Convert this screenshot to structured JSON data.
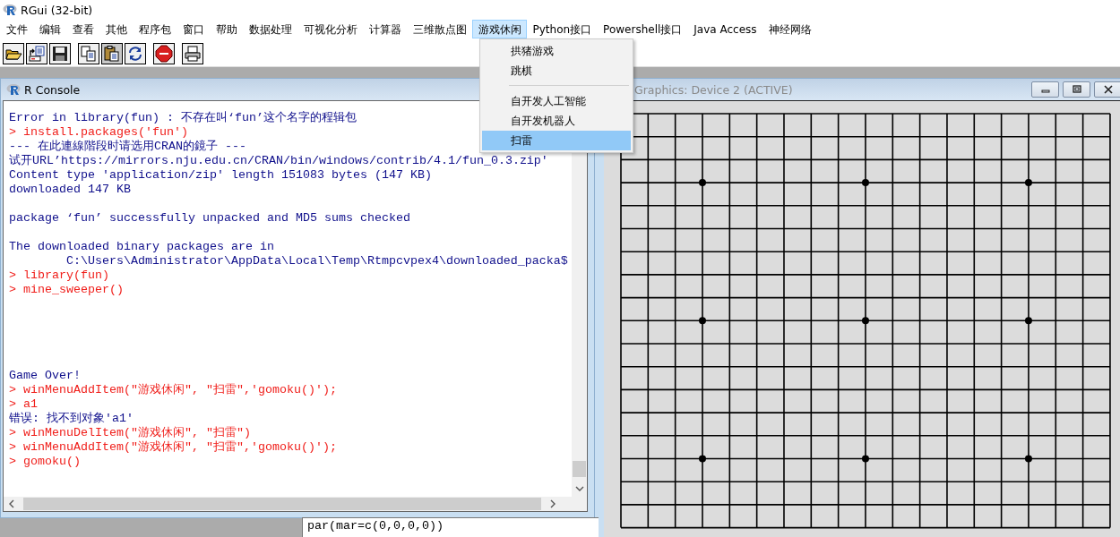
{
  "window": {
    "title": "RGui (32-bit)"
  },
  "menubar": [
    {
      "label": "文件",
      "selected": false
    },
    {
      "label": "编辑",
      "selected": false
    },
    {
      "label": "查看",
      "selected": false
    },
    {
      "label": "其他",
      "selected": false
    },
    {
      "label": "程序包",
      "selected": false
    },
    {
      "label": "窗口",
      "selected": false
    },
    {
      "label": "帮助",
      "selected": false
    },
    {
      "label": "数据处理",
      "selected": false
    },
    {
      "label": "可视化分析",
      "selected": false
    },
    {
      "label": "计算器",
      "selected": false
    },
    {
      "label": "三维散点图",
      "selected": false
    },
    {
      "label": "游戏休闲",
      "selected": true
    },
    {
      "label": "Python接口",
      "selected": false
    },
    {
      "label": "Powershell接口",
      "selected": false
    },
    {
      "label": "Java Access",
      "selected": false
    },
    {
      "label": "神经网络",
      "selected": false
    }
  ],
  "dropdown": [
    {
      "kind": "item",
      "label": "拱猪游戏",
      "selected": false
    },
    {
      "kind": "item",
      "label": "跳棋",
      "selected": false
    },
    {
      "kind": "separator"
    },
    {
      "kind": "item",
      "label": "自开发人工智能",
      "selected": false
    },
    {
      "kind": "item",
      "label": "自开发机器人",
      "selected": false
    },
    {
      "kind": "item",
      "label": "扫雷",
      "selected": true
    }
  ],
  "console": {
    "title": "R Console",
    "lines": [
      {
        "kind": "output",
        "text": "Error in library(fun) : 不存在叫‘fun’这个名字的程辑包"
      },
      {
        "kind": "input",
        "text": "> install.packages('fun')"
      },
      {
        "kind": "output",
        "text": "--- 在此連線階段时请选用CRAN的鏡子 ---"
      },
      {
        "kind": "output",
        "text": "试开URL’https://mirrors.nju.edu.cn/CRAN/bin/windows/contrib/4.1/fun_0.3.zip'"
      },
      {
        "kind": "output",
        "text": "Content type 'application/zip' length 151083 bytes (147 KB)"
      },
      {
        "kind": "output",
        "text": "downloaded 147 KB"
      },
      {
        "kind": "blank"
      },
      {
        "kind": "output",
        "text": "package ‘fun’ successfully unpacked and MD5 sums checked"
      },
      {
        "kind": "blank"
      },
      {
        "kind": "output",
        "text": "The downloaded binary packages are in"
      },
      {
        "kind": "output",
        "text": "        C:\\Users\\Administrator\\AppData\\Local\\Temp\\Rtmpcvpex4\\downloaded_packa$"
      },
      {
        "kind": "input",
        "text": "> library(fun)"
      },
      {
        "kind": "input",
        "text": "> mine_sweeper()"
      },
      {
        "kind": "blank"
      },
      {
        "kind": "blank"
      },
      {
        "kind": "blank"
      },
      {
        "kind": "blank"
      },
      {
        "kind": "blank"
      },
      {
        "kind": "output",
        "text": "Game Over!"
      },
      {
        "kind": "input",
        "text": "> winMenuAddItem(\"游戏休闲\", \"扫雷\",'gomoku()');"
      },
      {
        "kind": "input",
        "text": "> a1"
      },
      {
        "kind": "output",
        "text": "错误: 找不到对象'a1'"
      },
      {
        "kind": "input",
        "text": "> winMenuDelItem(\"游戏休闲\", \"扫雷\")"
      },
      {
        "kind": "input",
        "text": "> winMenuAddItem(\"游戏休闲\", \"扫雷\",'gomoku()');"
      },
      {
        "kind": "input",
        "text": "> gomoku()"
      }
    ]
  },
  "graphics": {
    "title": "Graphics: Device 2 (ACTIVE)"
  },
  "script_window": {
    "line": "par(mar=c(0,0,0,0))"
  }
}
